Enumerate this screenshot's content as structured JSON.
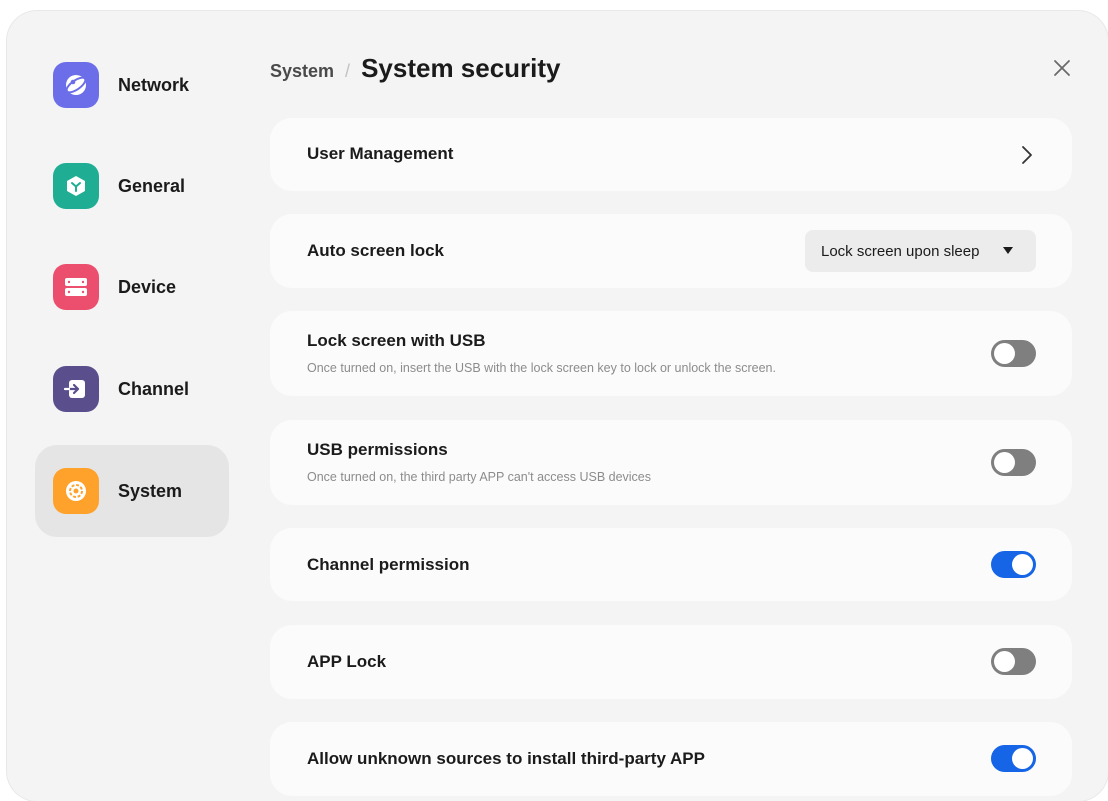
{
  "sidebar": {
    "items": [
      {
        "label": "Network",
        "icon": "globe-icon",
        "color": "#6b6ee8",
        "active": false
      },
      {
        "label": "General",
        "icon": "cube-icon",
        "color": "#1fae94",
        "active": false
      },
      {
        "label": "Device",
        "icon": "server-icon",
        "color": "#ec4f6e",
        "active": false
      },
      {
        "label": "Channel",
        "icon": "input-icon",
        "color": "#5a4f8c",
        "active": false
      },
      {
        "label": "System",
        "icon": "system-gear-icon",
        "color": "#ffa22b",
        "active": true
      }
    ]
  },
  "header": {
    "breadcrumb_parent": "System",
    "separator": "/",
    "title": "System security"
  },
  "settings": {
    "user_management": {
      "title": "User Management"
    },
    "auto_screen_lock": {
      "title": "Auto screen lock",
      "value": "Lock screen upon sleep"
    },
    "lock_screen_usb": {
      "title": "Lock screen with USB",
      "description": "Once turned on, insert the USB with the lock screen key to lock or unlock the screen.",
      "enabled": false
    },
    "usb_permissions": {
      "title": "USB permissions",
      "description": "Once turned on, the third party APP can't access USB devices",
      "enabled": false
    },
    "channel_permission": {
      "title": "Channel permission",
      "enabled": true
    },
    "app_lock": {
      "title": "APP Lock",
      "enabled": false
    },
    "unknown_sources": {
      "title": "Allow unknown sources to install third-party APP",
      "enabled": true
    }
  },
  "colors": {
    "accent": "#1565e6",
    "toggle_off": "#7f7f7f",
    "background": "#f4f4f4",
    "card": "#fbfbfb"
  }
}
